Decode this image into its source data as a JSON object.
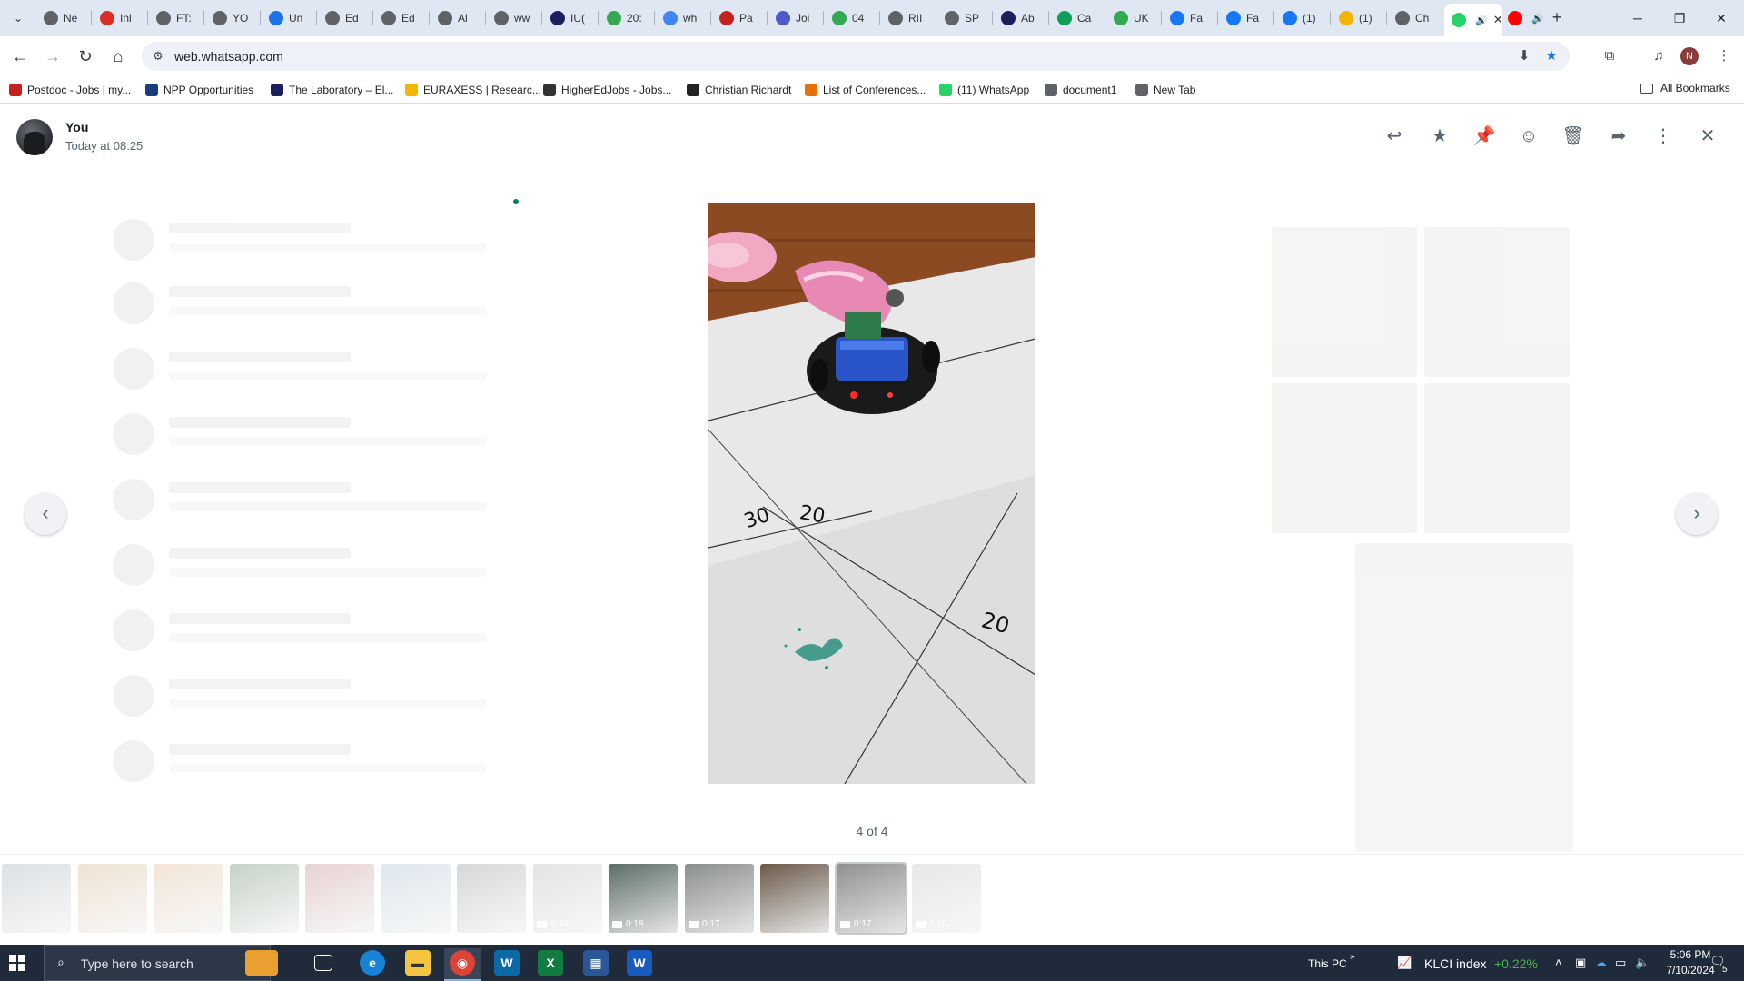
{
  "browser": {
    "tabs": [
      {
        "label": "Ne",
        "color": "#5f6368",
        "icon": "globe-icon"
      },
      {
        "label": "Inl",
        "color": "#d93025",
        "icon": "gmail-icon"
      },
      {
        "label": "FT:",
        "color": "#5f6368",
        "icon": "globe-icon"
      },
      {
        "label": "YO",
        "color": "#5f6368",
        "icon": "globe-icon"
      },
      {
        "label": "Un",
        "color": "#1a73e8",
        "icon": "unnamed-icon"
      },
      {
        "label": "Ed",
        "color": "#5f6368",
        "icon": "globe-icon"
      },
      {
        "label": "Ed",
        "color": "#5f6368",
        "icon": "globe-icon"
      },
      {
        "label": "Al",
        "color": "#5f6368",
        "icon": "globe-icon"
      },
      {
        "label": "ww",
        "color": "#5f6368",
        "icon": "globe-icon"
      },
      {
        "label": "IU(",
        "color": "#1b1f5e",
        "icon": "iu-icon"
      },
      {
        "label": "20:",
        "color": "#34a853",
        "icon": "drive-icon"
      },
      {
        "label": "wh",
        "color": "#4285f4",
        "icon": "google-icon"
      },
      {
        "label": "Pa",
        "color": "#c5221f",
        "icon": "pay-icon"
      },
      {
        "label": "Joi",
        "color": "#5059c9",
        "icon": "teams-icon"
      },
      {
        "label": "04",
        "color": "#34a853",
        "icon": "drive-icon"
      },
      {
        "label": "RII",
        "color": "#5f6368",
        "icon": "globe-icon"
      },
      {
        "label": "SP",
        "color": "#5f6368",
        "icon": "globe-icon"
      },
      {
        "label": "Ab",
        "color": "#1b1f5e",
        "icon": "globe-icon"
      },
      {
        "label": "Ca",
        "color": "#0f9d58",
        "icon": "sheets-icon"
      },
      {
        "label": "UK",
        "color": "#34a853",
        "icon": "drive-icon"
      },
      {
        "label": "Fa",
        "color": "#1877f2",
        "icon": "facebook-icon"
      },
      {
        "label": "Fa",
        "color": "#1877f2",
        "icon": "facebook-icon"
      },
      {
        "label": "(1)",
        "color": "#1877f2",
        "icon": "facebook-icon"
      },
      {
        "label": "(1)",
        "color": "#f4b400",
        "icon": "notify-icon"
      },
      {
        "label": "Ch",
        "color": "#5f6368",
        "icon": "chatgpt-icon"
      },
      {
        "label": "",
        "color": "#25d366",
        "icon": "whatsapp-icon",
        "active": true
      },
      {
        "label": "",
        "color": "#ff0000",
        "icon": "youtube-icon"
      }
    ],
    "url": "web.whatsapp.com",
    "bookmarks": [
      {
        "label": "Postdoc - Jobs | my...",
        "color": "#c5221f"
      },
      {
        "label": "NPP Opportunities",
        "color": "#1a3d7c"
      },
      {
        "label": "The Laboratory – El...",
        "color": "#1b1f5e"
      },
      {
        "label": "EURAXESS | Researc...",
        "color": "#f4b400"
      },
      {
        "label": "HigherEdJobs - Jobs...",
        "color": "#333333"
      },
      {
        "label": "Christian Richardt",
        "color": "#222222"
      },
      {
        "label": "List of Conferences...",
        "color": "#e8710a"
      },
      {
        "label": "(11) WhatsApp",
        "color": "#25d366"
      },
      {
        "label": "document1",
        "color": "#5f6368"
      },
      {
        "label": "New Tab",
        "color": "#5f6368"
      }
    ],
    "all_bookmarks": "All Bookmarks",
    "profile_initial": "N"
  },
  "viewer": {
    "sender": "You",
    "timestamp": "Today at 08:25",
    "counter": "4 of 4",
    "thumbnails": [
      {
        "duration": "",
        "tone": "#8c99a6",
        "faded": true
      },
      {
        "duration": "",
        "tone": "#c9a36b",
        "faded": true
      },
      {
        "duration": "",
        "tone": "#d7a979",
        "faded": true
      },
      {
        "duration": "",
        "tone": "#3f6b45",
        "faded": true
      },
      {
        "duration": "",
        "tone": "#b26b6b",
        "faded": true
      },
      {
        "duration": "",
        "tone": "#8fb0c4",
        "faded": true
      },
      {
        "duration": "",
        "tone": "#7c7c7c",
        "faded": true
      },
      {
        "duration": "0:15",
        "tone": "#a8a8a8",
        "faded": true
      },
      {
        "duration": "0:18",
        "tone": "#5b6e66",
        "faded": false
      },
      {
        "duration": "0:17",
        "tone": "#8b8e8f",
        "faded": false
      },
      {
        "duration": "",
        "tone": "#6b5a4a",
        "faded": false
      },
      {
        "duration": "0:17",
        "tone": "#909090",
        "faded": false,
        "selected": true
      },
      {
        "duration": "0:10",
        "tone": "#b4b4b4",
        "faded": true
      }
    ],
    "image_labels": [
      "30",
      "20",
      "20"
    ]
  },
  "taskbar": {
    "search_placeholder": "Type here to search",
    "this_pc": "This PC",
    "ticker": "KLCI index",
    "ticker_change": "+0.22%",
    "time": "5:06 PM",
    "date": "7/10/2024",
    "notifications": "5"
  }
}
